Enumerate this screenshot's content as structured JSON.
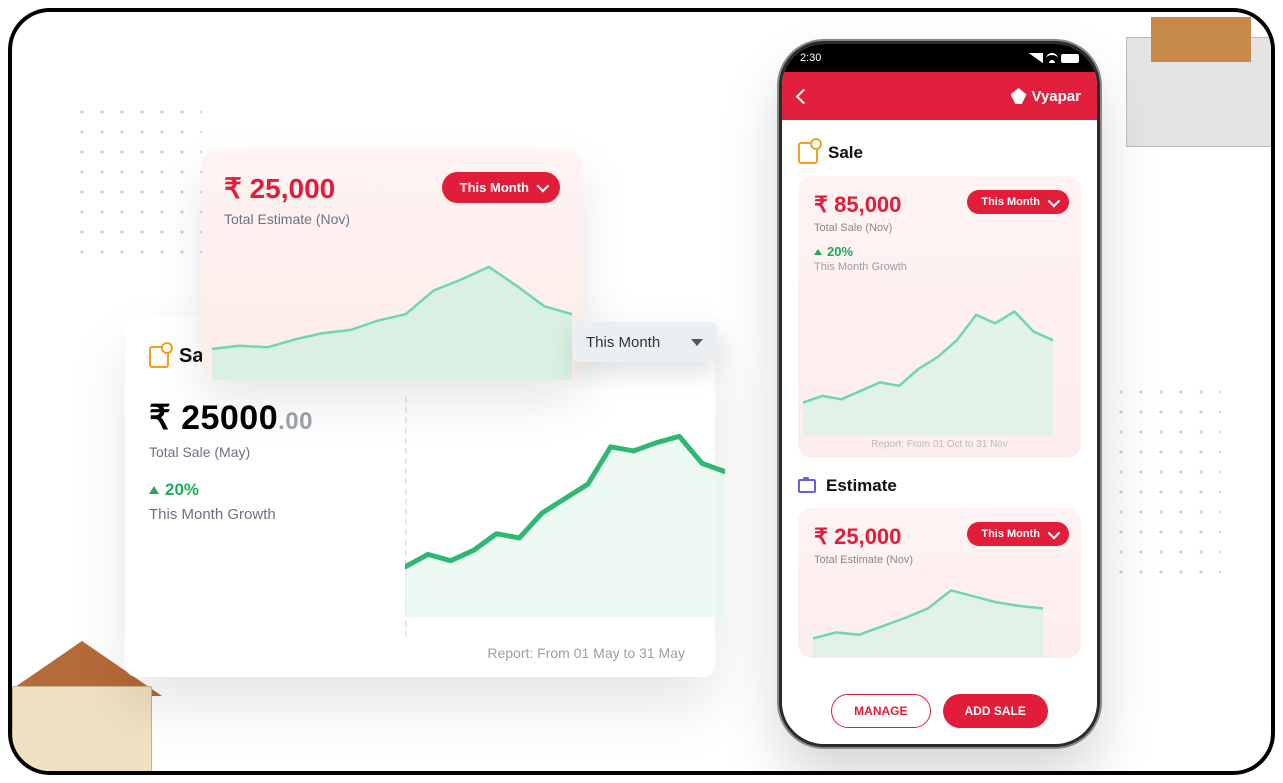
{
  "estimate_card": {
    "amount": "₹ 25,000",
    "period_label": "This Month",
    "subtitle": "Total Estimate (Nov)"
  },
  "sale_card": {
    "title": "Sale",
    "amount_int": "₹ 25000",
    "amount_dec": ".00",
    "subtitle": "Total Sale (May)",
    "growth_pct": "20%",
    "growth_label": "This Month Growth",
    "dropdown_label": "This Month",
    "report_text": "Report: From 01 May to 31 May"
  },
  "phone": {
    "time": "2:30",
    "brand": "Vyapar",
    "sale": {
      "title": "Sale",
      "amount": "₹ 85,000",
      "period_label": "This Month",
      "subtitle": "Total Sale (Nov)",
      "growth_pct": "20%",
      "growth_label": "This Month Growth",
      "report_text": "Report: From 01 Oct to 31 Nov"
    },
    "estimate": {
      "title": "Estimate",
      "amount": "₹ 25,000",
      "period_label": "This Month",
      "subtitle": "Total Estimate (Nov)"
    },
    "buttons": {
      "manage": "MANAGE",
      "add_sale": "ADD SALE"
    }
  },
  "chart_data": [
    {
      "type": "area",
      "owner": "estimate_card_spark",
      "x": [
        0,
        1,
        2,
        3,
        4,
        5,
        6,
        7,
        8,
        9,
        10,
        11,
        12,
        13
      ],
      "values": [
        18,
        20,
        19,
        24,
        28,
        30,
        36,
        40,
        55,
        62,
        70,
        58,
        45,
        40
      ],
      "ylim": [
        0,
        80
      ],
      "stroke": "#6fd7ae",
      "fill": "#c9f1df"
    },
    {
      "type": "line",
      "owner": "sale_card_chart",
      "x": [
        0,
        1,
        2,
        3,
        4,
        5,
        6,
        7,
        8,
        9,
        10,
        11,
        12,
        13,
        14
      ],
      "values": [
        22,
        28,
        25,
        30,
        38,
        36,
        48,
        55,
        62,
        80,
        78,
        82,
        85,
        72,
        68
      ],
      "ylim": [
        0,
        100
      ],
      "stroke": "#2fb774",
      "fill": "#e6f7ee"
    },
    {
      "type": "area",
      "owner": "phone_sale_spark",
      "x": [
        0,
        1,
        2,
        3,
        4,
        5,
        6,
        7,
        8,
        9,
        10,
        11,
        12,
        13
      ],
      "values": [
        18,
        22,
        20,
        25,
        30,
        28,
        38,
        45,
        55,
        70,
        65,
        72,
        60,
        55
      ],
      "ylim": [
        0,
        80
      ],
      "stroke": "#6fd7ae",
      "fill": "#d6f3e4"
    },
    {
      "type": "area",
      "owner": "phone_estimate_spark",
      "x": [
        0,
        1,
        2,
        3,
        4,
        5,
        6,
        7,
        8,
        9,
        10
      ],
      "values": [
        15,
        20,
        18,
        25,
        32,
        40,
        55,
        50,
        45,
        42,
        40
      ],
      "ylim": [
        0,
        60
      ],
      "stroke": "#6fd7ae",
      "fill": "#d6f3e4"
    }
  ]
}
